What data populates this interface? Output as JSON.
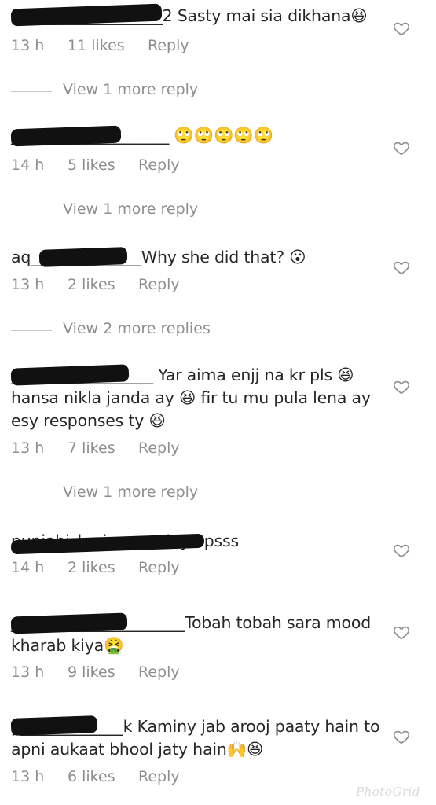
{
  "comments": [
    {
      "user": "k__________________2",
      "text": " Sasty mai sia dikhana😆",
      "time": "13 h",
      "likes": "11 likes",
      "reply": "Reply"
    },
    {
      "user": "____________________",
      "text": " 🙄🙄🙄🙄🙄",
      "time": "14 h",
      "likes": "5 likes",
      "reply": "Reply"
    },
    {
      "user": "aq______________",
      "text": "Why she did that? 😮",
      "time": "13 h",
      "likes": "2 likes",
      "reply": "Reply"
    },
    {
      "user": "__________________",
      "text": " Yar aima enjj na kr pls 😆 hansa nikla janda ay 😆 fir tu mu pula lena ay esy responses ty 😆",
      "time": "13 h",
      "likes": "7 likes",
      "reply": "Reply"
    },
    {
      "user": "punjabi_kuria_munday",
      "text": " opsss",
      "time": "14 h",
      "likes": "2 likes",
      "reply": "Reply"
    },
    {
      "user": "______________________",
      "text": "Tobah tobah sara mood kharab kiya🤮",
      "time": "13 h",
      "likes": "9 likes",
      "reply": "Reply"
    },
    {
      "user": "y_____________k",
      "text": " Kaminy jab arooj paaty hain to apni aukaat bhool jaty hain🙌😆",
      "time": "13 h",
      "likes": "6 likes",
      "reply": "Reply"
    }
  ],
  "view_more": [
    "View 1 more reply",
    "View 1 more reply",
    "View 2 more replies",
    "View 1 more reply"
  ],
  "icons": {
    "like": "heart-outline-icon"
  },
  "watermark": "PhotoGrid",
  "colors": {
    "text": "#262626",
    "meta": "#8e8e8e",
    "redaction": "#111111"
  }
}
